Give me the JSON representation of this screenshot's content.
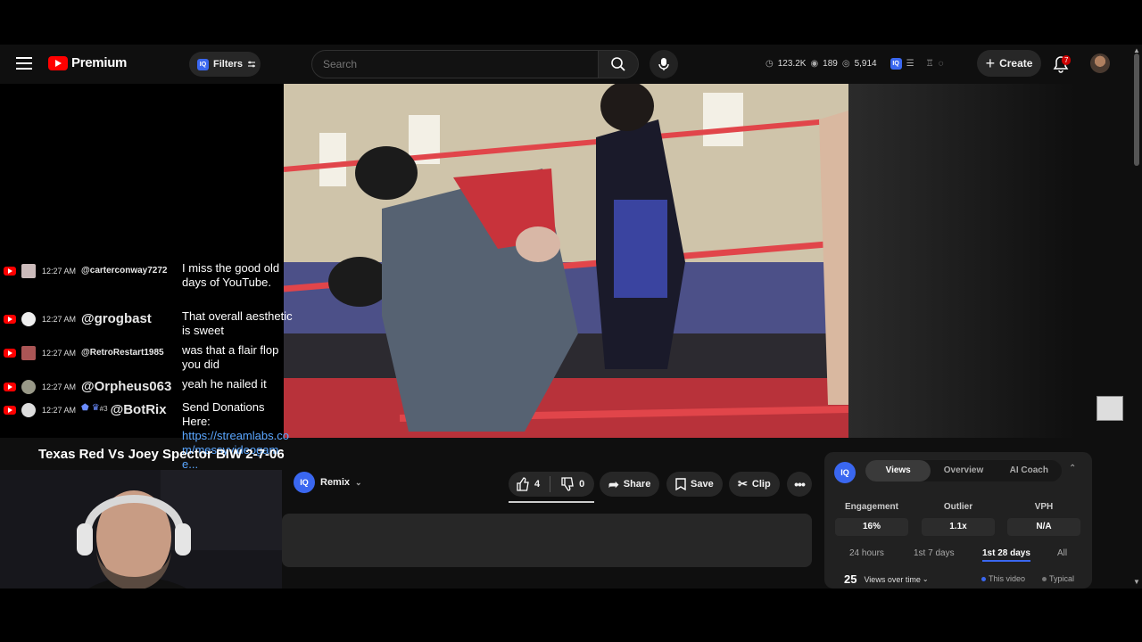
{
  "header": {
    "brand": "Premium",
    "filters_label": "Filters",
    "iq_label": "IQ",
    "search_placeholder": "Search",
    "stats": {
      "views": "123.2K",
      "subs": "189",
      "watch": "5,914"
    },
    "create_label": "Create",
    "notification_count": "7"
  },
  "chat": [
    {
      "time": "12:27 AM",
      "user": "@carterconway7272",
      "text": "I miss the good old days of YouTube."
    },
    {
      "time": "12:27 AM",
      "user": "@grogbast",
      "text": "That overall aesthetic is sweet"
    },
    {
      "time": "12:27 AM",
      "user": "@RetroRestart1985",
      "text": "was that a flair flop you did"
    },
    {
      "time": "12:27 AM",
      "user": "@Orpheus063",
      "text": "yeah he nailed it"
    },
    {
      "time": "12:27 AM",
      "user": "@BotRix",
      "badge": "#3",
      "text": "Send Donations Here:",
      "link": "https://streamlabs.com/messyvideogame..."
    }
  ],
  "video": {
    "title": "Texas Red Vs Joey Spector BIW 2-7-06",
    "remix_label": "Remix",
    "likes": "4",
    "dislikes": "0",
    "share_label": "Share",
    "save_label": "Save",
    "clip_label": "Clip"
  },
  "iq_panel": {
    "tabs": [
      "Views",
      "Overview",
      "AI Coach"
    ],
    "active_tab": "Views",
    "metrics": [
      {
        "label": "Engagement",
        "value": "16%"
      },
      {
        "label": "Outlier",
        "value": "1.1x"
      },
      {
        "label": "VPH",
        "value": "N/A"
      }
    ],
    "ranges": [
      "24 hours",
      "1st 7 days",
      "1st 28 days",
      "All"
    ],
    "active_range": "1st 28 days",
    "views_count": "25",
    "views_over_time_label": "Views over time",
    "legend_this": "This video",
    "legend_typical": "Typical",
    "accent_color": "#3a67f0"
  }
}
